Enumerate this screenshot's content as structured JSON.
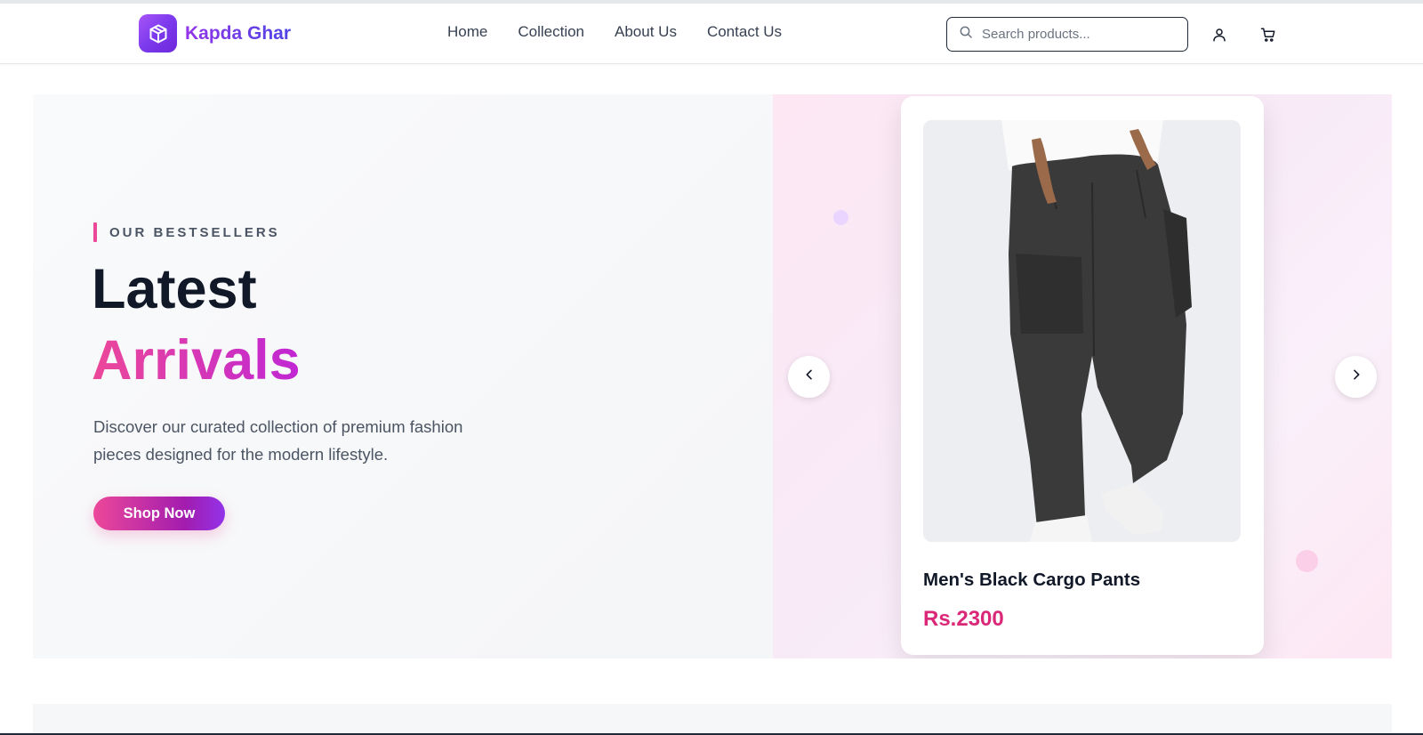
{
  "brand": {
    "name": "Kapda Ghar",
    "icon": "box-icon",
    "accent": "#7c3aed"
  },
  "nav": {
    "items": [
      {
        "label": "Home"
      },
      {
        "label": "Collection"
      },
      {
        "label": "About Us"
      },
      {
        "label": "Contact Us"
      }
    ]
  },
  "search": {
    "placeholder": "Search products...",
    "value": "",
    "icon": "search-icon"
  },
  "header_icons": {
    "user": "user-icon",
    "cart": "cart-icon"
  },
  "hero": {
    "eyebrow": "OUR BESTSELLERS",
    "title_line1": "Latest",
    "title_line2": "Arrivals",
    "description": "Discover our curated collection of premium fashion pieces designed for the modern lifestyle.",
    "cta_label": "Shop Now",
    "prev_icon": "chevron-left-icon",
    "next_icon": "chevron-right-icon"
  },
  "product": {
    "name": "Men's Black Cargo Pants",
    "price": "Rs.2300",
    "image": "black-cargo-pants-image"
  },
  "colors": {
    "pink": "#ec4899",
    "purple": "#9333ea",
    "price": "#db2777",
    "ink": "#111827"
  }
}
